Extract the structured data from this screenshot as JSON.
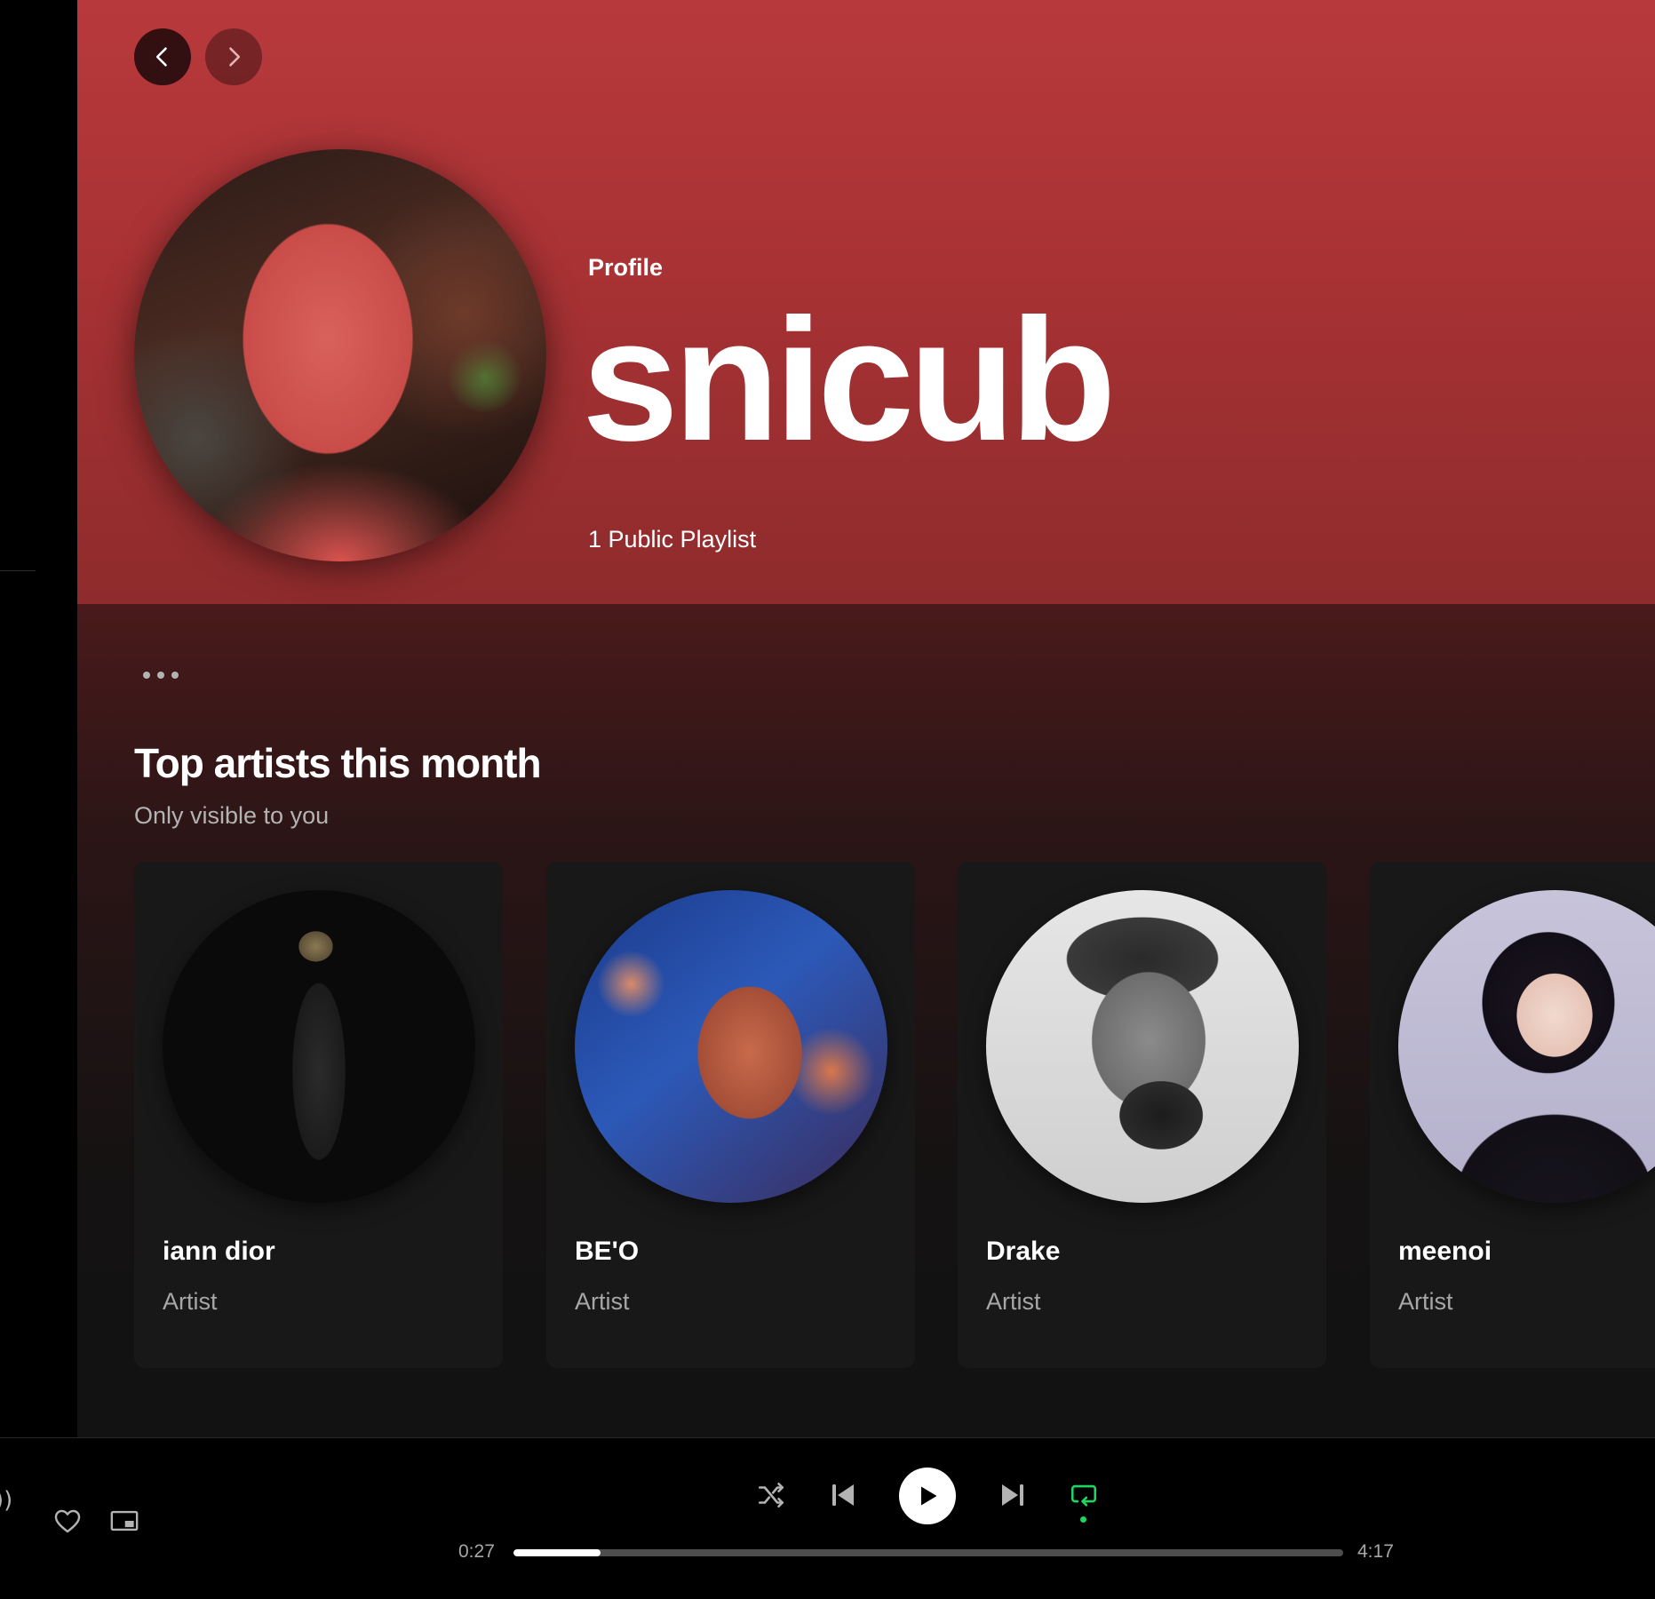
{
  "profile": {
    "label": "Profile",
    "name": "snicub",
    "meta": "1 Public Playlist"
  },
  "section": {
    "title": "Top artists this month",
    "subtitle": "Only visible to you"
  },
  "artists": [
    {
      "name": "iann dior",
      "type": "Artist"
    },
    {
      "name": "BE'O",
      "type": "Artist"
    },
    {
      "name": "Drake",
      "type": "Artist"
    },
    {
      "name": "meenoi",
      "type": "Artist"
    }
  ],
  "player": {
    "elapsed": "0:27",
    "duration": "4:17",
    "progress_fraction": 0.105,
    "repeat_active": true
  },
  "colors": {
    "accent": "#1ed760",
    "hero": "#b8393b"
  },
  "icons": {
    "back": "chevron-left-icon",
    "forward": "chevron-right-icon",
    "more": "more-icon",
    "like": "heart-icon",
    "miniplayer": "miniplayer-icon",
    "shuffle": "shuffle-icon",
    "previous": "skip-previous-icon",
    "play": "play-icon",
    "next": "skip-next-icon",
    "repeat": "repeat-icon"
  }
}
